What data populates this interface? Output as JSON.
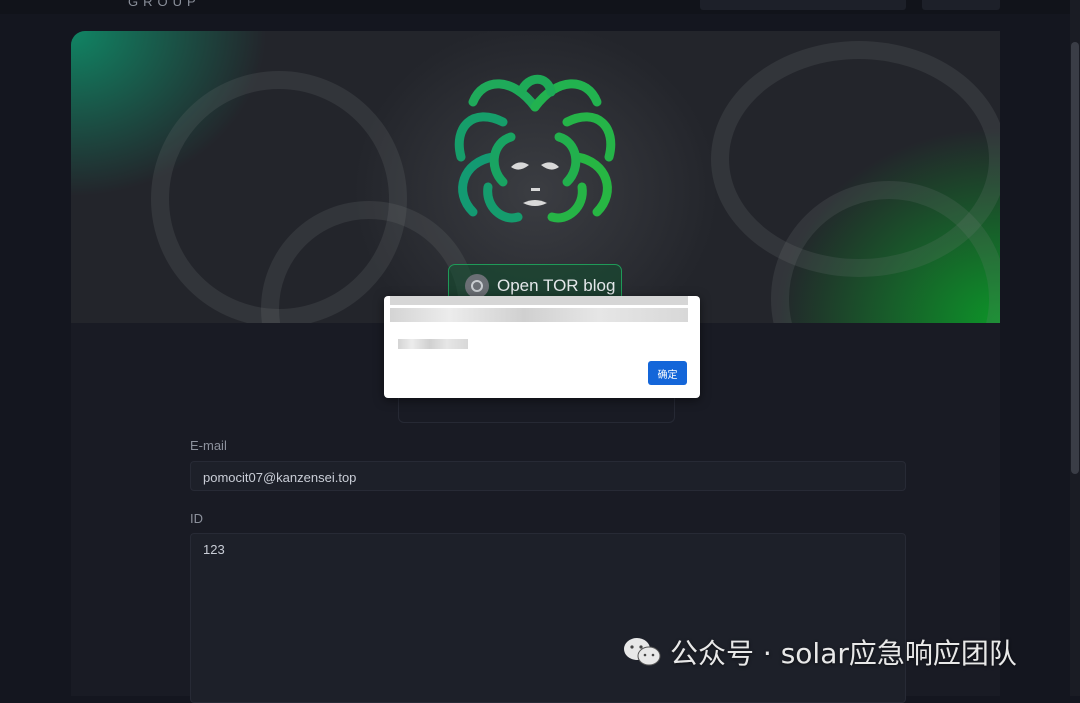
{
  "header": {
    "brand_sub": "GROUP"
  },
  "hero": {
    "tor_button_label": "Open TOR blog"
  },
  "dialog": {
    "ok_label": "确定"
  },
  "form": {
    "email_label": "E-mail",
    "email_value": "pomocit07@kanzensei.top",
    "id_label": "ID",
    "id_value": "123"
  },
  "watermark": {
    "text": "公众号 · solar应急响应团队"
  },
  "colors": {
    "accent_green": "#1f9a58",
    "dialog_button": "#1466d9",
    "background": "#14161f"
  },
  "icons": [
    "tor-onion-icon",
    "medusa-logo-icon",
    "wechat-icon"
  ]
}
